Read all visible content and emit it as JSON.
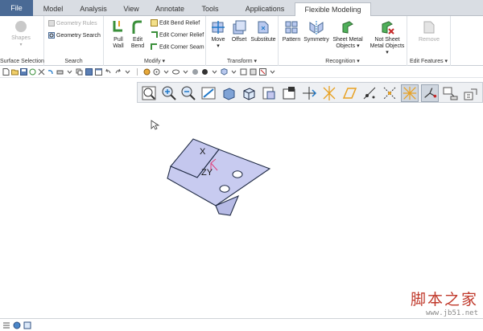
{
  "tabs": [
    "File",
    "Model",
    "Analysis",
    "View",
    "Annotate",
    "Tools",
    "Applications",
    "Flexible Modeling"
  ],
  "active_tab": "Flexible Modeling",
  "ribbon": {
    "surface_selection": {
      "shapes": "Shapes",
      "label": "Surface Selection"
    },
    "search": {
      "geometry_rules": "Geometry Rules",
      "geometry_search": "Geometry Search",
      "label": "Search"
    },
    "modify": {
      "pull_wall": [
        "Pull",
        "Wall"
      ],
      "edit_bend": [
        "Edit",
        "Bend"
      ],
      "edit_bend_relief": "Edit Bend Relief",
      "edit_corner_relief": "Edit Corner Relief",
      "edit_corner_seam": "Edit Corner Seam",
      "label": "Modify ▾"
    },
    "transform": {
      "move": [
        "Move",
        "▾"
      ],
      "offset": "Offset",
      "substitute": "Substitute",
      "label": "Transform ▾"
    },
    "recognition": {
      "pattern": "Pattern",
      "symmetry": "Symmetry",
      "sheet_metal_objects": [
        "Sheet Metal",
        "Objects ▾"
      ],
      "not_sheet_metal_objects": [
        "Not Sheet",
        "Metal Objects ▾"
      ],
      "label": "Recognition ▾"
    },
    "edit_features": {
      "remove": "Remove",
      "label": "Edit Features ▾"
    }
  },
  "canvas": {
    "csys_x": "X",
    "csys_zy": "ZY"
  },
  "watermark": {
    "main": "脚本之家",
    "url": "www.jb51.net"
  },
  "colors": {
    "file_tab": "#4a6a95",
    "part_face": "#c4c7ee",
    "part_edge": "#1f2a44",
    "accent": "#1f78c8"
  }
}
